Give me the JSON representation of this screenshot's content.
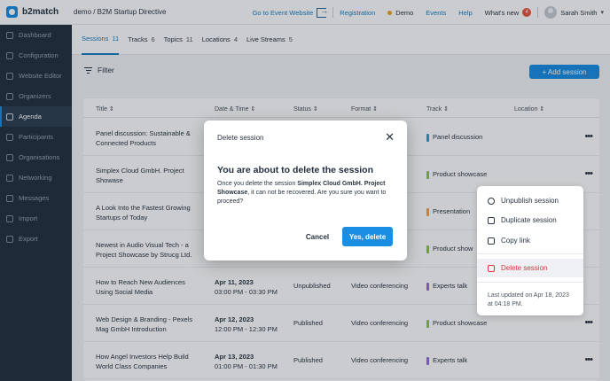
{
  "app": {
    "brand": "b2match",
    "event": "demo / B2M Startup Directive"
  },
  "topbar": {
    "go_to_event": "Go to Event Website",
    "registration": "Registration",
    "demo": "Demo",
    "events": "Events",
    "help": "Help",
    "whats_new": "What's new",
    "whats_new_count": "4",
    "user": "Sarah Smith"
  },
  "sidebar": {
    "items": [
      {
        "label": "Dashboard"
      },
      {
        "label": "Configuration"
      },
      {
        "label": "Website Editor"
      },
      {
        "label": "Organizers"
      },
      {
        "label": "Agenda"
      },
      {
        "label": "Participants"
      },
      {
        "label": "Organisations"
      },
      {
        "label": "Networking"
      },
      {
        "label": "Messages"
      },
      {
        "label": "Import"
      },
      {
        "label": "Export"
      }
    ]
  },
  "tabs": [
    {
      "label": "Sessions",
      "count": "11"
    },
    {
      "label": "Tracks",
      "count": "6"
    },
    {
      "label": "Topics",
      "count": "11"
    },
    {
      "label": "Locations",
      "count": "4"
    },
    {
      "label": "Live Streams",
      "count": "5"
    }
  ],
  "toolbar": {
    "filter": "Filter",
    "add_session": "+ Add session"
  },
  "table": {
    "headers": {
      "title": "Title",
      "date": "Date & Time",
      "status": "Status",
      "format": "Format",
      "track": "Track",
      "location": "Location"
    },
    "rows": [
      {
        "title1": "Panel discussion: Sustainable &",
        "title2": "Connected Products",
        "date": "",
        "time": "",
        "status": "",
        "format": "",
        "track": "Panel discussion",
        "track_color": "#2aa6c4"
      },
      {
        "title1": "Simplex Cloud GmbH. Project",
        "title2": "Showase",
        "date": "",
        "time": "",
        "status": "",
        "format": "",
        "track": "Product showcase",
        "track_color": "#8bc34a"
      },
      {
        "title1": "A Look Into the Fastest Growing",
        "title2": "Startups of Today",
        "date": "",
        "time": "",
        "status": "",
        "format": "",
        "track": "Presentation",
        "track_color": "#f0a050"
      },
      {
        "title1": "Newest in Audio Visual Tech - a",
        "title2": "Project Showcase by Strucg Ltd.",
        "date": "",
        "time": "",
        "status": "",
        "format": "",
        "track": "Product show",
        "track_color": "#8bc34a"
      },
      {
        "title1": "How to Reach New Audiences",
        "title2": "Using Social Media",
        "date": "Apr 11, 2023",
        "time": "03:00 PM - 03:30 PM",
        "status": "Unpublished",
        "format": "Video conferencing",
        "track": "Experts talk",
        "track_color": "#9b6ad8"
      },
      {
        "title1": "Web Design & Branding - Pexels",
        "title2": "Mag GmbH Introduction",
        "date": "Apr 12, 2023",
        "time": "12:00 PM - 12:30 PM",
        "status": "Published",
        "format": "Video conferencing",
        "track": "Product showcase",
        "track_color": "#8bc34a"
      },
      {
        "title1": "How Angel Investors Help Build",
        "title2": "World Class Companies",
        "date": "Apr 13, 2023",
        "time": "01:00 PM - 01:30 PM",
        "status": "Published",
        "format": "Video conferencing",
        "track": "Experts talk",
        "track_color": "#9b6ad8"
      }
    ]
  },
  "context_menu": {
    "unpublish": "Unpublish session",
    "duplicate": "Duplicate session",
    "copy_link": "Copy link",
    "delete": "Delete session",
    "last_updated_1": "Last updated on Apr 18, 2023",
    "last_updated_2": "at 04:18 PM."
  },
  "modal": {
    "header": "Delete session",
    "title": "You are about to delete the session",
    "body_prefix": "Once you delete the session ",
    "session_name": "Simplex Cloud GmbH. Project Showcase",
    "body_suffix": ", it can not be recovered. Are you sure you want to proceed?",
    "cancel": "Cancel",
    "confirm": "Yes, delete"
  },
  "colors": {
    "accent": "#1a8ee3",
    "danger": "#d9363e",
    "sidebar": "#22313f"
  }
}
